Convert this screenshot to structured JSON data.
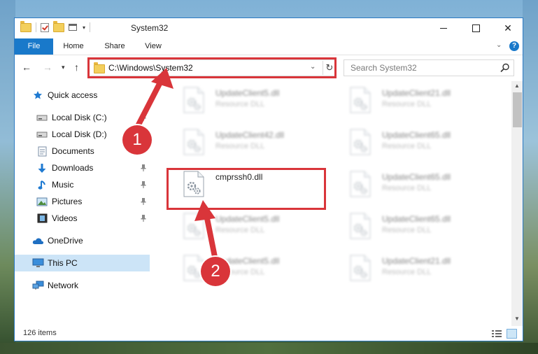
{
  "window": {
    "title": "System32",
    "controls": {
      "minimize": "—",
      "maximize": "☐",
      "close": "✕"
    }
  },
  "ribbon": {
    "tabs": [
      {
        "label": "File"
      },
      {
        "label": "Home"
      },
      {
        "label": "Share"
      },
      {
        "label": "View"
      }
    ],
    "help_label": "?"
  },
  "address": {
    "path": "C:\\Windows\\System32",
    "refresh_icon": "↻"
  },
  "search": {
    "placeholder": "Search System32"
  },
  "navigation": {
    "items": [
      {
        "label": "Quick access",
        "icon": "star-icon",
        "pinned": false
      },
      {
        "label": "Local Disk (C:)",
        "icon": "drive-icon",
        "pinned": true
      },
      {
        "label": "Local Disk (D:)",
        "icon": "drive-icon",
        "pinned": false
      },
      {
        "label": "Documents",
        "icon": "documents-icon",
        "pinned": true
      },
      {
        "label": "Downloads",
        "icon": "download-icon",
        "pinned": true
      },
      {
        "label": "Music",
        "icon": "music-icon",
        "pinned": true
      },
      {
        "label": "Pictures",
        "icon": "pictures-icon",
        "pinned": true
      },
      {
        "label": "Videos",
        "icon": "videos-icon",
        "pinned": true
      },
      {
        "label": "OneDrive",
        "icon": "cloud-icon",
        "pinned": false
      },
      {
        "label": "This PC",
        "icon": "computer-icon",
        "pinned": false,
        "selected": true
      },
      {
        "label": "Network",
        "icon": "network-icon",
        "pinned": false
      }
    ]
  },
  "files": [
    {
      "name": "UpdateClient5.dll",
      "type": "Resource DLL",
      "blurred": true
    },
    {
      "name": "UpdateClient21.dll",
      "type": "Resource DLL",
      "blurred": true
    },
    {
      "name": "UpdateClient42.dll",
      "type": "Resource DLL",
      "blurred": true
    },
    {
      "name": "UpdateClient65.dll",
      "type": "Resource DLL",
      "blurred": true
    },
    {
      "name": "cmprssh0.dll",
      "type": "",
      "blurred": false,
      "highlighted": true
    },
    {
      "name": "UpdateClient65.dll",
      "type": "Resource DLL",
      "blurred": true
    },
    {
      "name": "UpdateClient5.dll",
      "type": "Resource DLL",
      "blurred": true
    },
    {
      "name": "UpdateClient65.dll",
      "type": "Resource DLL",
      "blurred": true
    },
    {
      "name": "UpdateClient5.dll",
      "type": "Resource DLL",
      "blurred": true
    },
    {
      "name": "UpdateClient21.dll",
      "type": "Resource DLL",
      "blurred": true
    }
  ],
  "status": {
    "item_count": "126 items"
  },
  "annotations": {
    "callout_1": "1",
    "callout_2": "2",
    "color": "#d9353a"
  },
  "colors": {
    "accent": "#1979ca",
    "selection": "#cce4f7"
  }
}
